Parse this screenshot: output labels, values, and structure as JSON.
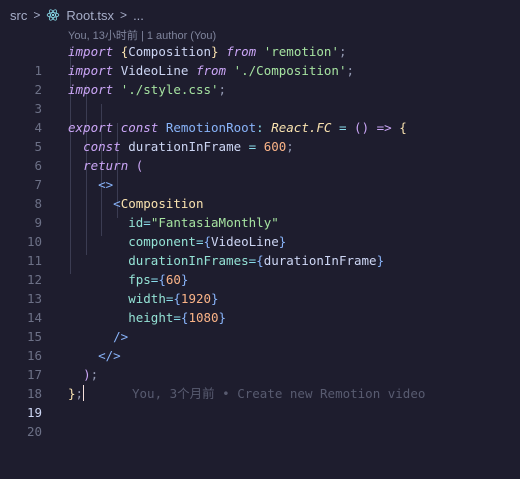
{
  "breadcrumb": {
    "folder": "src",
    "file": "Root.tsx",
    "more": "..."
  },
  "codelens": "You, 13小时前 | 1 author (You)",
  "gutter": [
    "1",
    "2",
    "3",
    "4",
    "5",
    "6",
    "7",
    "8",
    "9",
    "10",
    "11",
    "12",
    "13",
    "14",
    "15",
    "16",
    "17",
    "18",
    "19",
    "20"
  ],
  "code": {
    "l1": {
      "import": "import",
      "open": "{",
      "name": "Composition",
      "close": "}",
      "from": "from",
      "str": "'remotion'",
      "semi": ";"
    },
    "l2": {
      "import": "import",
      "name": "VideoLine",
      "from": "from",
      "str": "'./Composition'",
      "semi": ";"
    },
    "l3": {
      "import": "import",
      "str": "'./style.css'",
      "semi": ";"
    },
    "l5": {
      "export": "export",
      "const": "const",
      "name": "RemotionRoot",
      "colon": ":",
      "type": "React.FC",
      "eq": "=",
      "parens": "()",
      "arrow": "=>",
      "brace": "{"
    },
    "l6": {
      "const": "const",
      "name": "durationInFrame",
      "eq": "=",
      "num": "600",
      "semi": ";"
    },
    "l7": {
      "return": "return",
      "paren": "("
    },
    "l8": {
      "frag": "<>"
    },
    "l9": {
      "lt": "<",
      "tag": "Composition"
    },
    "l10": {
      "attr": "id",
      "eq": "=",
      "str": "\"FantasiaMonthly\""
    },
    "l11": {
      "attr": "component",
      "eq": "=",
      "open": "{",
      "val": "VideoLine",
      "close": "}"
    },
    "l12": {
      "attr": "durationInFrames",
      "eq": "=",
      "open": "{",
      "val": "durationInFrame",
      "close": "}"
    },
    "l13": {
      "attr": "fps",
      "eq": "=",
      "open": "{",
      "val": "60",
      "close": "}"
    },
    "l14": {
      "attr": "width",
      "eq": "=",
      "open": "{",
      "val": "1920",
      "close": "}"
    },
    "l15": {
      "attr": "height",
      "eq": "=",
      "open": "{",
      "val": "1080",
      "close": "}"
    },
    "l16": {
      "close": "/>"
    },
    "l17": {
      "frag": "</>"
    },
    "l18": {
      "paren": ")",
      "semi": ";"
    },
    "l19": {
      "brace": "}",
      "semi": ";"
    }
  },
  "blame": "You, 3个月前 • Create new Remotion video",
  "active_line": "19"
}
